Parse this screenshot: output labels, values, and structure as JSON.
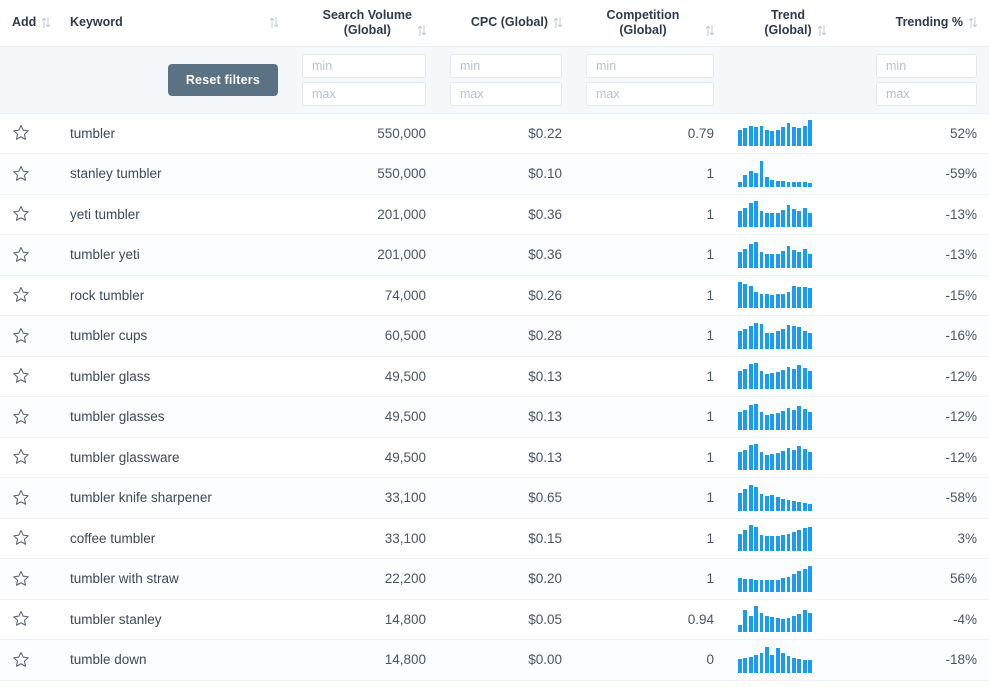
{
  "table": {
    "columns": [
      {
        "key": "add",
        "label": "Add",
        "label2": "",
        "align": "left",
        "sortable": true
      },
      {
        "key": "kw",
        "label": "Keyword",
        "label2": "",
        "align": "left",
        "sortable": true
      },
      {
        "key": "sv",
        "label": "Search Volume",
        "label2": "(Global)",
        "align": "right",
        "sortable": true
      },
      {
        "key": "cpc",
        "label": "CPC (Global)",
        "label2": "",
        "align": "right",
        "sortable": true
      },
      {
        "key": "comp",
        "label": "Competition (Global)",
        "label2": "",
        "align": "right",
        "sortable": true
      },
      {
        "key": "trend",
        "label": "Trend",
        "label2": "(Global)",
        "align": "center",
        "sortable": true
      },
      {
        "key": "pct",
        "label": "Trending %",
        "label2": "",
        "align": "right",
        "sortable": true
      }
    ],
    "filters": {
      "reset_label": "Reset filters",
      "min_placeholder": "min",
      "max_placeholder": "max",
      "search_volume": {
        "min": "",
        "max": ""
      },
      "cpc": {
        "min": "",
        "max": ""
      },
      "competition": {
        "min": "",
        "max": ""
      },
      "trending_pct": {
        "min": "",
        "max": ""
      }
    },
    "rows": [
      {
        "keyword": "tumbler",
        "volume": "550,000",
        "cpc": "$0.22",
        "competition": "0.79",
        "trending": "52%",
        "trend": [
          62,
          70,
          75,
          72,
          78,
          62,
          58,
          60,
          72,
          88,
          72,
          70,
          78,
          100
        ]
      },
      {
        "keyword": "stanley tumbler",
        "volume": "550,000",
        "cpc": "$0.10",
        "competition": "1",
        "trending": "-59%",
        "trend": [
          20,
          48,
          62,
          52,
          100,
          40,
          28,
          24,
          22,
          20,
          20,
          18,
          18,
          16
        ]
      },
      {
        "keyword": "yeti tumbler",
        "volume": "201,000",
        "cpc": "$0.36",
        "competition": "1",
        "trending": "-13%",
        "trend": [
          58,
          68,
          85,
          92,
          56,
          48,
          50,
          48,
          60,
          78,
          62,
          58,
          68,
          50
        ]
      },
      {
        "keyword": "tumbler yeti",
        "volume": "201,000",
        "cpc": "$0.36",
        "competition": "1",
        "trending": "-13%",
        "trend": [
          58,
          68,
          85,
          92,
          56,
          48,
          50,
          48,
          60,
          78,
          62,
          58,
          68,
          50
        ]
      },
      {
        "keyword": "rock tumbler",
        "volume": "74,000",
        "cpc": "$0.26",
        "competition": "1",
        "trending": "-15%",
        "trend": [
          95,
          88,
          82,
          60,
          52,
          50,
          48,
          50,
          52,
          58,
          80,
          78,
          76,
          72
        ]
      },
      {
        "keyword": "tumbler cups",
        "volume": "60,500",
        "cpc": "$0.28",
        "competition": "1",
        "trending": "-16%",
        "trend": [
          62,
          70,
          82,
          92,
          88,
          58,
          56,
          62,
          70,
          84,
          82,
          78,
          62,
          58
        ]
      },
      {
        "keyword": "tumbler glass",
        "volume": "49,500",
        "cpc": "$0.13",
        "competition": "1",
        "trending": "-12%",
        "trend": [
          62,
          72,
          88,
          92,
          62,
          54,
          56,
          60,
          66,
          78,
          72,
          84,
          76,
          62
        ]
      },
      {
        "keyword": "tumbler glasses",
        "volume": "49,500",
        "cpc": "$0.13",
        "competition": "1",
        "trending": "-12%",
        "trend": [
          62,
          72,
          88,
          92,
          62,
          54,
          56,
          60,
          66,
          78,
          72,
          84,
          76,
          62
        ]
      },
      {
        "keyword": "tumbler glassware",
        "volume": "49,500",
        "cpc": "$0.13",
        "competition": "1",
        "trending": "-12%",
        "trend": [
          62,
          72,
          88,
          92,
          62,
          54,
          56,
          60,
          66,
          78,
          72,
          84,
          76,
          62
        ]
      },
      {
        "keyword": "tumbler knife sharpener",
        "volume": "33,100",
        "cpc": "$0.65",
        "competition": "1",
        "trending": "-58%",
        "trend": [
          66,
          80,
          96,
          88,
          62,
          56,
          58,
          50,
          44,
          42,
          38,
          34,
          30,
          26
        ]
      },
      {
        "keyword": "coffee tumbler",
        "volume": "33,100",
        "cpc": "$0.15",
        "competition": "1",
        "trending": "3%",
        "trend": [
          56,
          72,
          88,
          82,
          54,
          50,
          52,
          50,
          54,
          58,
          64,
          72,
          78,
          80
        ]
      },
      {
        "keyword": "tumbler with straw",
        "volume": "22,200",
        "cpc": "$0.20",
        "competition": "1",
        "trending": "56%",
        "trend": [
          52,
          50,
          50,
          48,
          48,
          46,
          46,
          48,
          52,
          58,
          70,
          82,
          90,
          100
        ]
      },
      {
        "keyword": "tumbler stanley",
        "volume": "14,800",
        "cpc": "$0.05",
        "competition": "0.94",
        "trending": "-4%",
        "trend": [
          18,
          60,
          42,
          70,
          52,
          44,
          40,
          38,
          36,
          38,
          42,
          48,
          60,
          52
        ]
      },
      {
        "keyword": "tumble down",
        "volume": "14,800",
        "cpc": "$0.00",
        "competition": "0",
        "trending": "-18%",
        "trend": [
          48,
          52,
          56,
          62,
          70,
          90,
          64,
          88,
          70,
          58,
          52,
          48,
          46,
          44
        ]
      }
    ]
  },
  "icons": {
    "star": "star-outline-icon",
    "sort": "sort-updown-icon"
  },
  "colors": {
    "spark_bar": "#1c9bf0",
    "reset_button": "#5b7284",
    "header_text": "#2f3a4f",
    "body_text": "#4a5568",
    "filter_bg": "#f4f8fb"
  }
}
